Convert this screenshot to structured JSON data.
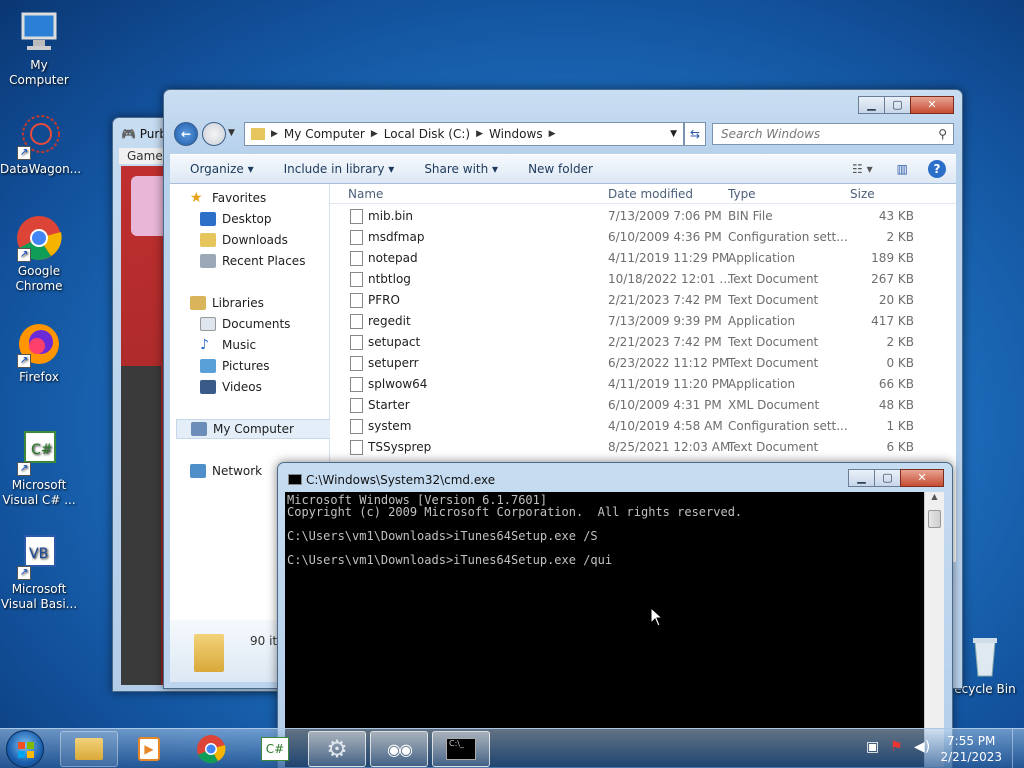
{
  "desktop": {
    "icons": [
      {
        "label": "My Computer"
      },
      {
        "label": "DataWagon..."
      },
      {
        "label": "Google Chrome"
      },
      {
        "label": "Firefox"
      },
      {
        "label": "Microsoft Visual C# ..."
      },
      {
        "label": "Microsoft Visual Basi..."
      },
      {
        "label": "ecycle Bin"
      }
    ]
  },
  "game_window": {
    "title": "Purb",
    "menu": "Game"
  },
  "explorer": {
    "address": [
      "My Computer",
      "Local Disk (C:)",
      "Windows"
    ],
    "search_placeholder": "Search Windows",
    "toolbar": {
      "organize": "Organize ▾",
      "include": "Include in library ▾",
      "share": "Share with ▾",
      "new_folder": "New folder"
    },
    "nav": {
      "favorites": "Favorites",
      "desktop": "Desktop",
      "downloads": "Downloads",
      "recent": "Recent Places",
      "libraries": "Libraries",
      "documents": "Documents",
      "music": "Music",
      "pictures": "Pictures",
      "videos": "Videos",
      "computer": "My Computer",
      "network": "Network"
    },
    "columns": {
      "name": "Name",
      "date": "Date modified",
      "type": "Type",
      "size": "Size"
    },
    "files": [
      {
        "name": "mib.bin",
        "date": "7/13/2009 7:06 PM",
        "type": "BIN File",
        "size": "43 KB"
      },
      {
        "name": "msdfmap",
        "date": "6/10/2009 4:36 PM",
        "type": "Configuration sett...",
        "size": "2 KB"
      },
      {
        "name": "notepad",
        "date": "4/11/2019 11:29 PM",
        "type": "Application",
        "size": "189 KB"
      },
      {
        "name": "ntbtlog",
        "date": "10/18/2022 12:01 ...",
        "type": "Text Document",
        "size": "267 KB"
      },
      {
        "name": "PFRO",
        "date": "2/21/2023 7:42 PM",
        "type": "Text Document",
        "size": "20 KB"
      },
      {
        "name": "regedit",
        "date": "7/13/2009 9:39 PM",
        "type": "Application",
        "size": "417 KB"
      },
      {
        "name": "setupact",
        "date": "2/21/2023 7:42 PM",
        "type": "Text Document",
        "size": "2 KB"
      },
      {
        "name": "setuperr",
        "date": "6/23/2022 11:12 PM",
        "type": "Text Document",
        "size": "0 KB"
      },
      {
        "name": "splwow64",
        "date": "4/11/2019 11:20 PM",
        "type": "Application",
        "size": "66 KB"
      },
      {
        "name": "Starter",
        "date": "6/10/2009 4:31 PM",
        "type": "XML Document",
        "size": "48 KB"
      },
      {
        "name": "system",
        "date": "4/10/2019 4:58 AM",
        "type": "Configuration sett...",
        "size": "1 KB"
      },
      {
        "name": "TSSysprep",
        "date": "8/25/2021 12:03 AM",
        "type": "Text Document",
        "size": "6 KB"
      }
    ],
    "status_count": "90 it"
  },
  "cmd": {
    "title": "C:\\Windows\\System32\\cmd.exe",
    "lines": [
      "Microsoft Windows [Version 6.1.7601]",
      "Copyright (c) 2009 Microsoft Corporation.  All rights reserved.",
      "",
      "C:\\Users\\vm1\\Downloads>iTunes64Setup.exe /S",
      "",
      "C:\\Users\\vm1\\Downloads>iTunes64Setup.exe /qui"
    ]
  },
  "taskbar": {
    "time": "7:55 PM",
    "date": "2/21/2023"
  }
}
